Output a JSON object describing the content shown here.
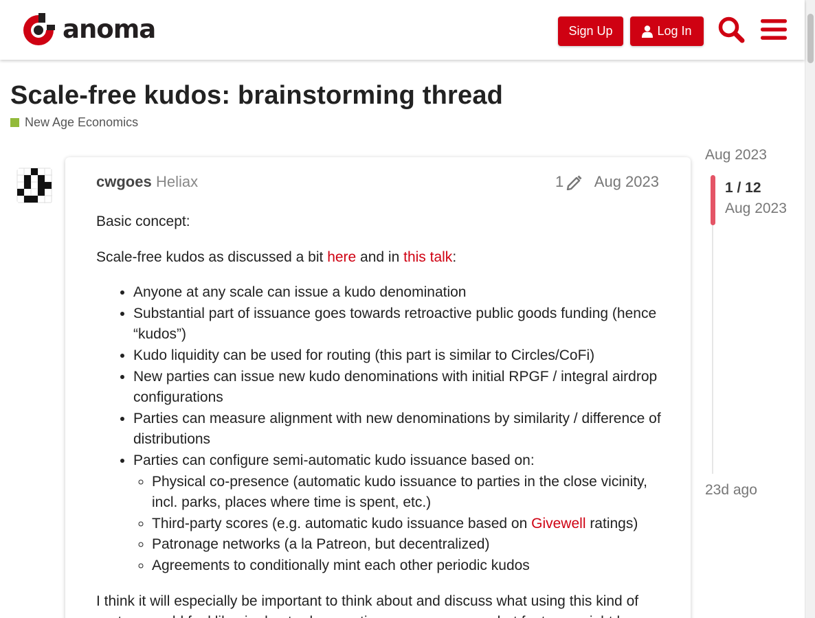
{
  "header": {
    "logo_text": "anoma",
    "signup_label": "Sign Up",
    "login_label": "Log In",
    "accent_color": "#cf0112",
    "search_icon": "search-icon",
    "menu_icon": "hamburger-menu-icon"
  },
  "topic": {
    "title": "Scale-free kudos: brainstorming thread",
    "category": "New Age Economics",
    "category_color": "#92ba3a"
  },
  "post": {
    "author": "cwgoes",
    "group": "Heliax",
    "edit_count": "1",
    "date": "Aug 2023",
    "p1": "Basic concept:",
    "p2_pre": "Scale-free kudos as discussed a bit ",
    "p2_link1": "here",
    "p2_mid": " and in ",
    "p2_link2": "this talk",
    "p2_post": ":",
    "bullets": [
      "Anyone at any scale can issue a kudo denomination",
      "Substantial part of issuance goes towards retroactive public goods funding (hence “kudos”)",
      "Kudo liquidity can be used for routing (this part is similar to Circles/CoFi)",
      "New parties can issue new kudo denominations with initial RPGF / integral airdrop configurations",
      "Parties can measure alignment with new denominations by similarity / difference of distributions",
      "Parties can configure semi-automatic kudo issuance based on:"
    ],
    "sub_bullets": {
      "s0": "Physical co-presence (automatic kudo issuance to parties in the close vicinity, incl. parks, places where time is spent, etc.)",
      "s1_pre": "Third-party scores (e.g. automatic kudo issuance based on ",
      "s1_link": "Givewell",
      "s1_post": " ratings)",
      "s2": "Patronage networks (a la Patreon, but decentralized)",
      "s3": "Agreements to conditionally mint each other periodic kudos"
    },
    "p3": "I think it will especially be important to think about and discuss what using this kind of system would feel like, in day-to-day practice, so we can see what features might be"
  },
  "timeline": {
    "top_date": "Aug 2023",
    "progress": "1 / 12",
    "progress_date": "Aug 2023",
    "bottom_date": "23d ago"
  }
}
